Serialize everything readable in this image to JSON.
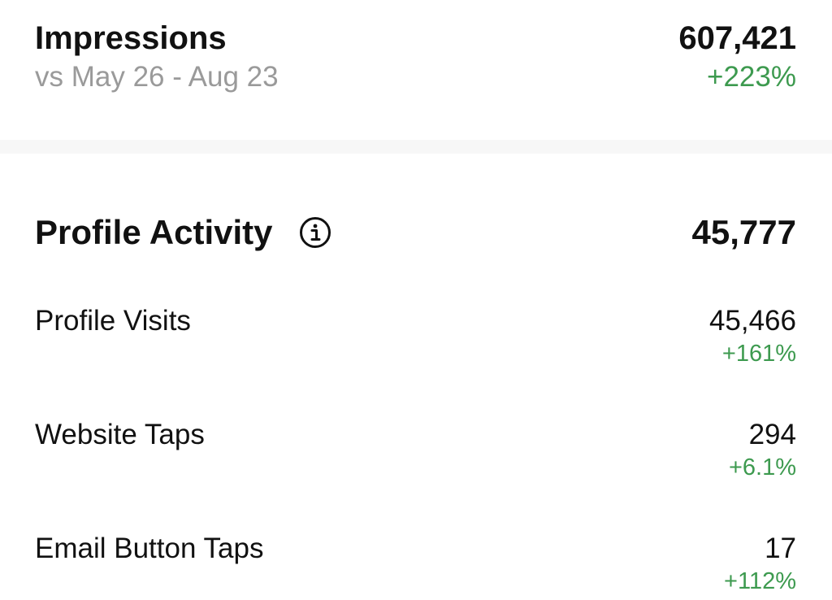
{
  "impressions": {
    "title": "Impressions",
    "comparison": "vs May 26 - Aug 23",
    "value": "607,421",
    "change": "+223%"
  },
  "profile_activity": {
    "title": "Profile Activity",
    "info_icon": "info-circle-icon",
    "value": "45,777",
    "metrics": [
      {
        "label": "Profile Visits",
        "value": "45,466",
        "change": "+161%"
      },
      {
        "label": "Website Taps",
        "value": "294",
        "change": "+6.1%"
      },
      {
        "label": "Email Button Taps",
        "value": "17",
        "change": "+112%"
      }
    ]
  },
  "colors": {
    "positive_change": "#3d9a4f",
    "secondary_text": "#9a9a9a",
    "primary_text": "#111111",
    "divider": "#f7f7f7"
  }
}
